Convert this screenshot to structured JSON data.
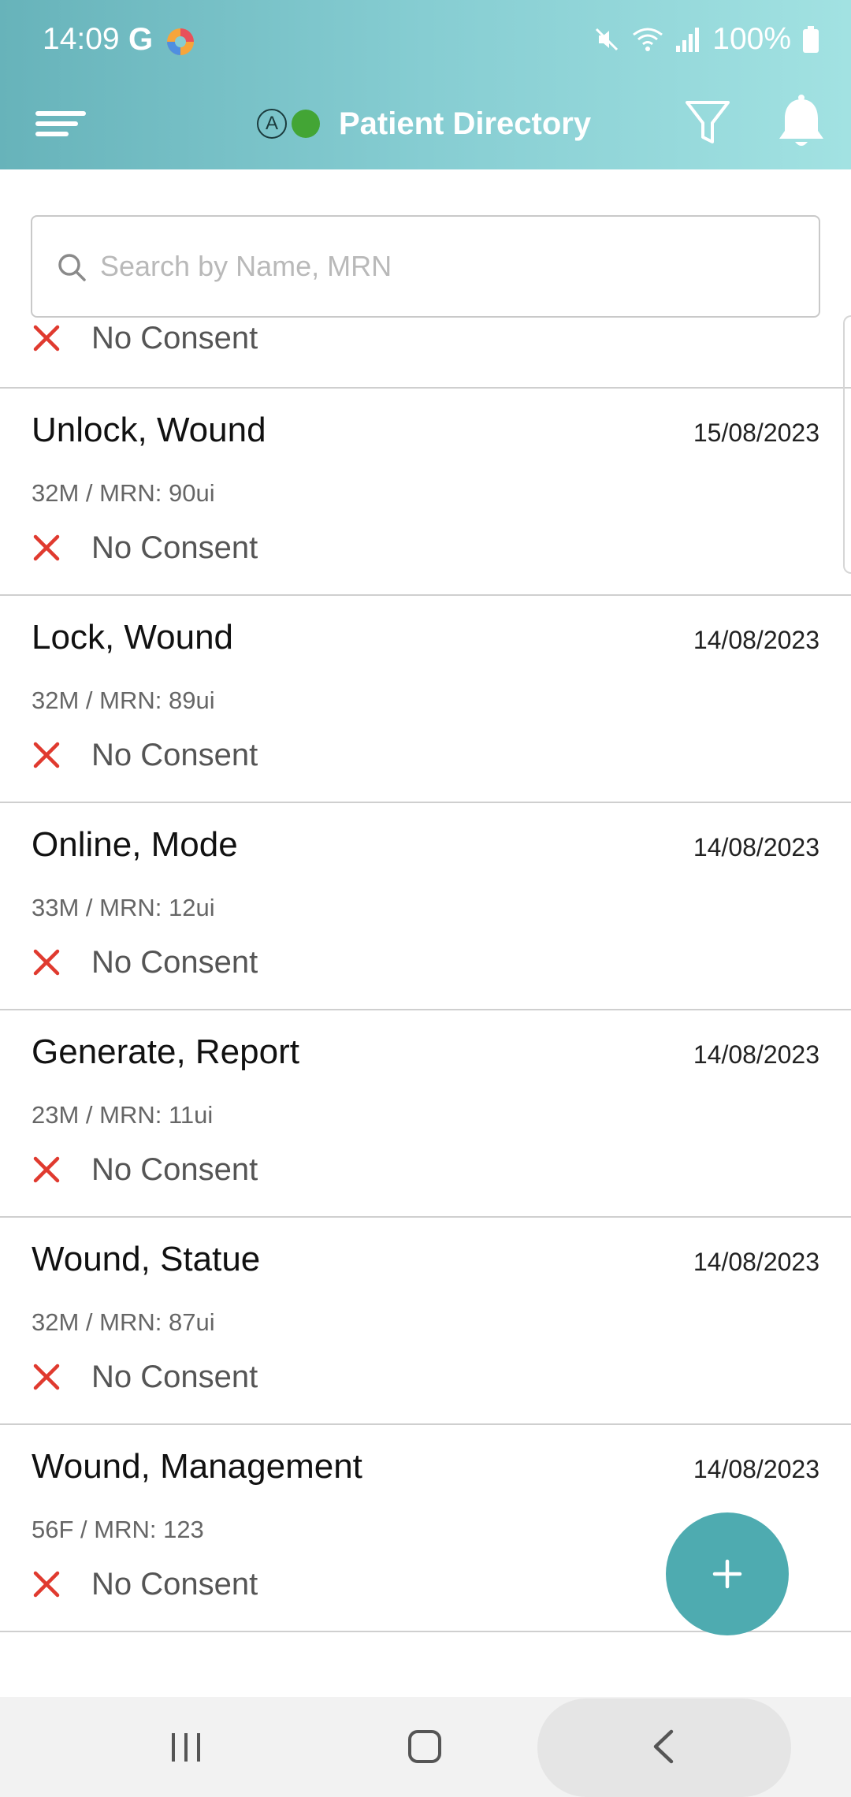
{
  "status_bar": {
    "time": "14:09",
    "google_letter": "G",
    "battery_text": "100%",
    "icons": [
      "mute-icon",
      "wifi-icon",
      "signal-icon",
      "battery-icon"
    ]
  },
  "toolbar": {
    "title": "Patient Directory",
    "auto_badge": "A",
    "online_status_color": "#43a535",
    "icons": [
      "menu-icon",
      "filter-icon",
      "bell-icon"
    ]
  },
  "search": {
    "placeholder": "Search by Name, MRN",
    "value": ""
  },
  "partial_row": {
    "consent": "No Consent"
  },
  "patients": [
    {
      "name": "Unlock, Wound",
      "date": "15/08/2023",
      "meta": "32M / MRN: 90ui",
      "consent": "No Consent"
    },
    {
      "name": "Lock, Wound",
      "date": "14/08/2023",
      "meta": "32M / MRN: 89ui",
      "consent": "No Consent"
    },
    {
      "name": "Online, Mode",
      "date": "14/08/2023",
      "meta": "33M / MRN: 12ui",
      "consent": "No Consent"
    },
    {
      "name": "Generate, Report",
      "date": "14/08/2023",
      "meta": "23M / MRN: 11ui",
      "consent": "No Consent"
    },
    {
      "name": "Wound, Statue",
      "date": "14/08/2023",
      "meta": "32M / MRN: 87ui",
      "consent": "No Consent"
    },
    {
      "name": "Wound, Management",
      "date": "14/08/2023",
      "meta": "56F / MRN: 123",
      "consent": "No Consent"
    }
  ],
  "fab": {
    "label": "+"
  },
  "colors": {
    "header_start": "#67b3ba",
    "header_end": "#a2e2e2",
    "fab": "#4eabb0",
    "no_consent_icon": "#e03a2f"
  }
}
